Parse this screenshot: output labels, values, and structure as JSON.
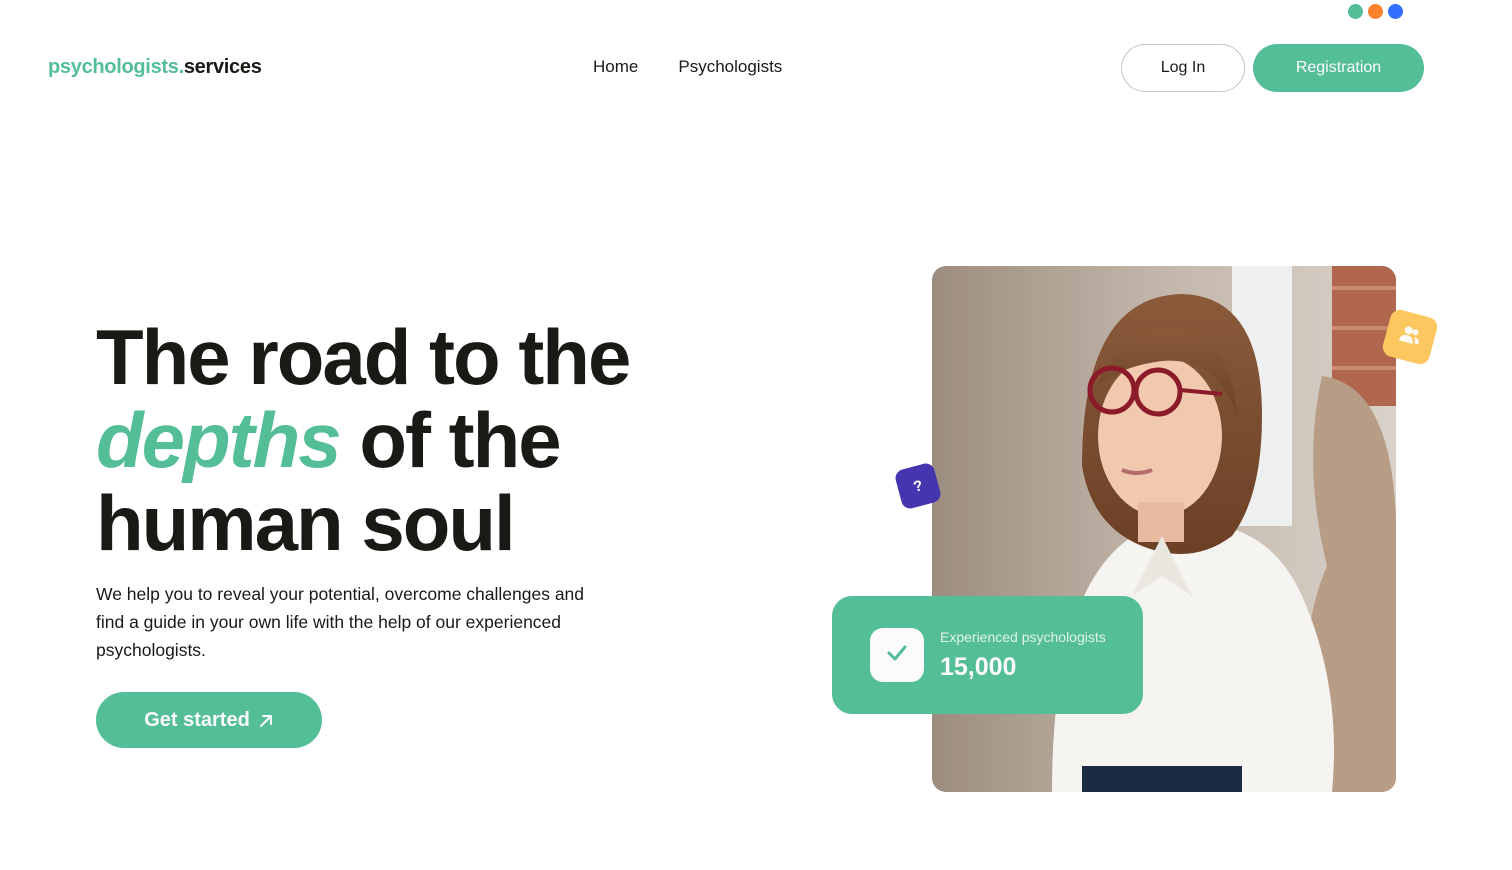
{
  "header": {
    "logo_accent": "psychologists.",
    "logo_rest": "services",
    "nav": [
      "Home",
      "Psychologists"
    ],
    "login_label": "Log In",
    "register_label": "Registration"
  },
  "theme_colors": [
    "#54be96",
    "#fc832c",
    "#3470ff"
  ],
  "hero": {
    "title_line1": "The road to the",
    "title_accent": "depths",
    "title_line2_rest": " of the",
    "title_line3": "human soul",
    "description": "We help you to reveal your potential, overcome challenges and find a guide in your own life with the help of our experienced psychologists.",
    "cta_label": "Get started",
    "cta_icon": "arrow-up-right-icon"
  },
  "badges": {
    "users_icon": "users-icon",
    "question_text": "?"
  },
  "stat": {
    "icon": "check-icon",
    "label": "Experienced psychologists",
    "value": "15,000"
  },
  "colors": {
    "accent": "#54be96",
    "yellow": "#fbc75e",
    "purple": "#4535af",
    "text": "#191a15"
  }
}
